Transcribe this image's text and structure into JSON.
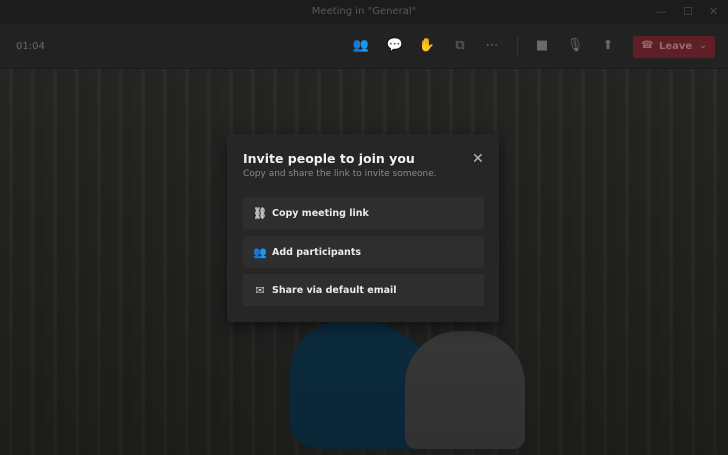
{
  "window": {
    "title": "Meeting in \"General\""
  },
  "toolbar": {
    "timer": "01:04",
    "leave_label": "Leave"
  },
  "dialog": {
    "title": "Invite people to join you",
    "subtitle": "Copy and share the link to invite someone.",
    "options": [
      {
        "label": "Copy meeting link",
        "icon": "link-icon"
      },
      {
        "label": "Add participants",
        "icon": "add-people-icon"
      },
      {
        "label": "Share via default email",
        "icon": "mail-icon"
      }
    ]
  },
  "colors": {
    "leave": "#5e1f26",
    "dialog": "#262626"
  }
}
